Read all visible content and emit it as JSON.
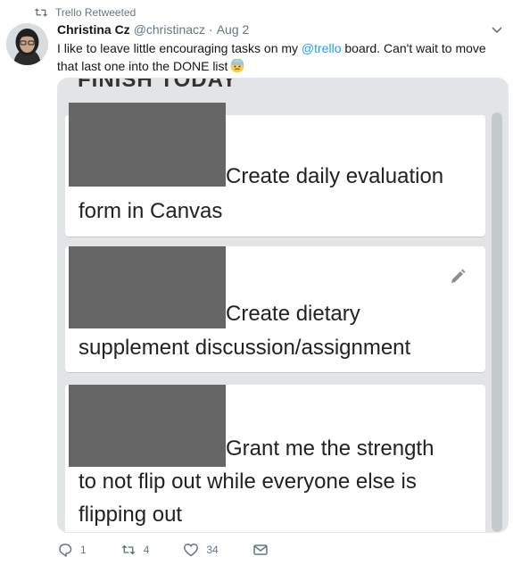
{
  "retweet": {
    "label": "Trello Retweeted",
    "icon": "retweet-icon"
  },
  "tweet": {
    "author_name": "Christina Cz",
    "author_handle": "@christinacz",
    "separator": "·",
    "timestamp": "Aug 2",
    "text_before": "I like to leave little encouraging tasks on my ",
    "mention": "@trello",
    "text_after": " board. Can't wait to move that last one into the DONE list",
    "emoji": "anxious-face-emoji"
  },
  "trello": {
    "list_title": "FINISH TODAY",
    "cards": [
      {
        "line1": "Create daily evaluation",
        "line2": "form in Canvas"
      },
      {
        "line1": "Create dietary",
        "line2": "supplement discussion/assignment"
      },
      {
        "line1": "Grant me the strength",
        "line2": "to not flip out while everyone else is",
        "line3": "flipping out"
      }
    ]
  },
  "actions": {
    "reply_count": "1",
    "retweet_count": "4",
    "like_count": "34"
  },
  "colors": {
    "link": "#1da1f2",
    "secondary_text": "#657786",
    "redaction": "#666666",
    "board_bg": "#e2e4e6"
  }
}
